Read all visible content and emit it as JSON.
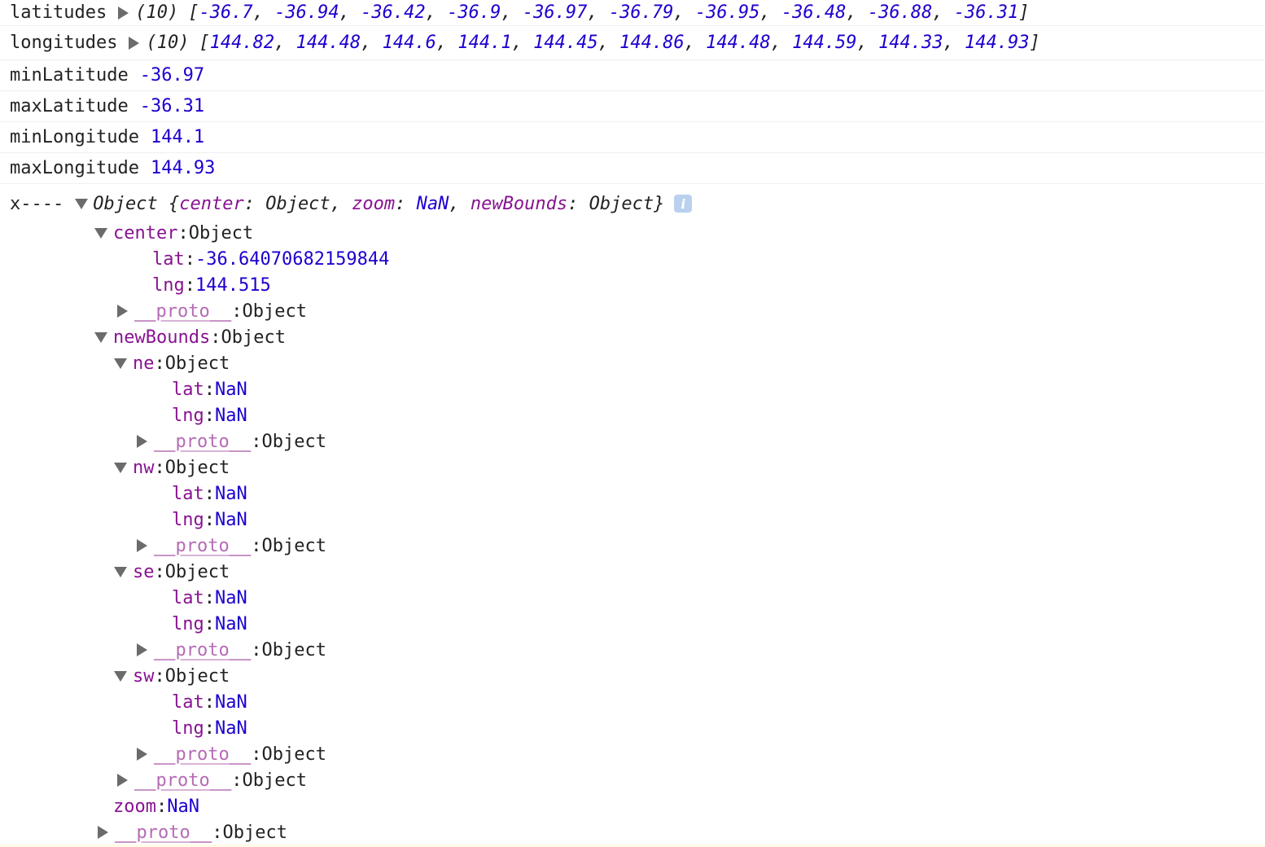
{
  "arrays": [
    {
      "label": "latitudes",
      "count": "(10)",
      "values": [
        "-36.7",
        "-36.94",
        "-36.42",
        "-36.9",
        "-36.97",
        "-36.79",
        "-36.95",
        "-36.48",
        "-36.88",
        "-36.31"
      ]
    },
    {
      "label": "longitudes",
      "count": "(10)",
      "values": [
        "144.82",
        "144.48",
        "144.6",
        "144.1",
        "144.45",
        "144.86",
        "144.48",
        "144.59",
        "144.33",
        "144.93"
      ]
    }
  ],
  "scalars": [
    {
      "label": "minLatitude",
      "value": "-36.97"
    },
    {
      "label": "maxLatitude",
      "value": "-36.31"
    },
    {
      "label": "minLongitude",
      "value": "144.1"
    },
    {
      "label": "maxLongitude",
      "value": "144.93"
    }
  ],
  "object_log": {
    "label": "x----",
    "summary": {
      "type": "Object",
      "center_key": "center",
      "center_val": "Object",
      "zoom_key": "zoom",
      "zoom_val": "NaN",
      "bounds_key": "newBounds",
      "bounds_val": "Object",
      "info_icon": "info-icon"
    }
  },
  "tree": [
    {
      "depth": 0,
      "toggle": "down",
      "key": "center",
      "keyStyle": "key",
      "value": "Object",
      "valueStyle": "plain"
    },
    {
      "depth": 1,
      "toggle": "none",
      "key": "lat",
      "keyStyle": "key",
      "value": "-36.64070682159844",
      "valueStyle": "num"
    },
    {
      "depth": 1,
      "toggle": "none",
      "key": "lng",
      "keyStyle": "key",
      "value": "144.515",
      "valueStyle": "num"
    },
    {
      "depth": 0,
      "toggle": "right",
      "key": "__proto__",
      "keyStyle": "pkey",
      "value": "Object",
      "valueStyle": "plain",
      "offset": 1
    },
    {
      "depth": 0,
      "toggle": "down",
      "key": "newBounds",
      "keyStyle": "key",
      "value": "Object",
      "valueStyle": "plain"
    },
    {
      "depth": 1,
      "toggle": "down",
      "key": "ne",
      "keyStyle": "key",
      "value": "Object",
      "valueStyle": "plain"
    },
    {
      "depth": 2,
      "toggle": "none",
      "key": "lat",
      "keyStyle": "key",
      "value": "NaN",
      "valueStyle": "num"
    },
    {
      "depth": 2,
      "toggle": "none",
      "key": "lng",
      "keyStyle": "key",
      "value": "NaN",
      "valueStyle": "num"
    },
    {
      "depth": 1,
      "toggle": "right",
      "key": "__proto__",
      "keyStyle": "pkey",
      "value": "Object",
      "valueStyle": "plain",
      "offset": 1
    },
    {
      "depth": 1,
      "toggle": "down",
      "key": "nw",
      "keyStyle": "key",
      "value": "Object",
      "valueStyle": "plain"
    },
    {
      "depth": 2,
      "toggle": "none",
      "key": "lat",
      "keyStyle": "key",
      "value": "NaN",
      "valueStyle": "num"
    },
    {
      "depth": 2,
      "toggle": "none",
      "key": "lng",
      "keyStyle": "key",
      "value": "NaN",
      "valueStyle": "num"
    },
    {
      "depth": 1,
      "toggle": "right",
      "key": "__proto__",
      "keyStyle": "pkey",
      "value": "Object",
      "valueStyle": "plain",
      "offset": 1
    },
    {
      "depth": 1,
      "toggle": "down",
      "key": "se",
      "keyStyle": "key",
      "value": "Object",
      "valueStyle": "plain"
    },
    {
      "depth": 2,
      "toggle": "none",
      "key": "lat",
      "keyStyle": "key",
      "value": "NaN",
      "valueStyle": "num"
    },
    {
      "depth": 2,
      "toggle": "none",
      "key": "lng",
      "keyStyle": "key",
      "value": "NaN",
      "valueStyle": "num"
    },
    {
      "depth": 1,
      "toggle": "right",
      "key": "__proto__",
      "keyStyle": "pkey",
      "value": "Object",
      "valueStyle": "plain",
      "offset": 1
    },
    {
      "depth": 1,
      "toggle": "down",
      "key": "sw",
      "keyStyle": "key",
      "value": "Object",
      "valueStyle": "plain"
    },
    {
      "depth": 2,
      "toggle": "none",
      "key": "lat",
      "keyStyle": "key",
      "value": "NaN",
      "valueStyle": "num"
    },
    {
      "depth": 2,
      "toggle": "none",
      "key": "lng",
      "keyStyle": "key",
      "value": "NaN",
      "valueStyle": "num"
    },
    {
      "depth": 1,
      "toggle": "right",
      "key": "__proto__",
      "keyStyle": "pkey",
      "value": "Object",
      "valueStyle": "plain",
      "offset": 1
    },
    {
      "depth": 0,
      "toggle": "right",
      "key": "__proto__",
      "keyStyle": "pkey",
      "value": "Object",
      "valueStyle": "plain",
      "offset": 1
    },
    {
      "depth": 0,
      "toggle": "none",
      "key": "zoom",
      "keyStyle": "key",
      "value": "NaN",
      "valueStyle": "num",
      "offset": 1
    },
    {
      "depth": 0,
      "toggle": "right",
      "key": "__proto__",
      "keyStyle": "pkey",
      "value": "Object",
      "valueStyle": "plain"
    }
  ],
  "colors": {
    "number": "#1c00cf",
    "key": "#881391",
    "proto_key": "#b56cb5",
    "triangle": "#6b6b6b",
    "info_badge": "#bad0ef"
  }
}
